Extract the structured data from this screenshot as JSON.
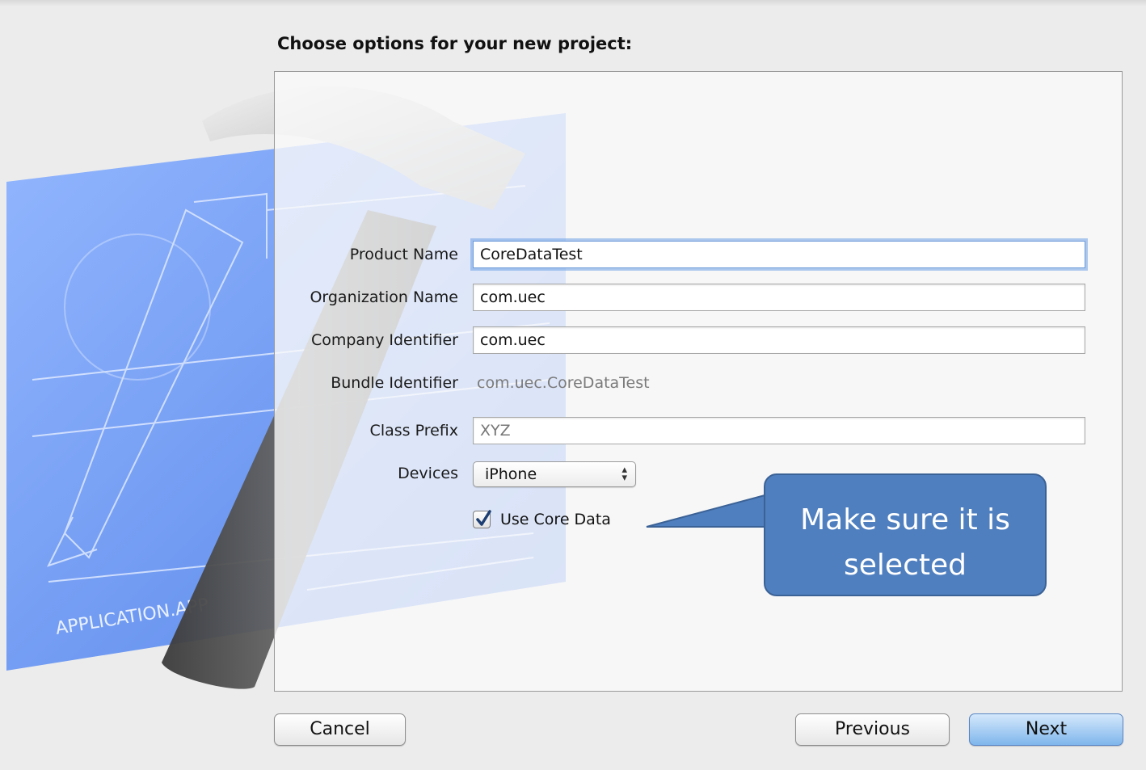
{
  "dialog": {
    "heading": "Choose options for your new project:"
  },
  "artwork": {
    "label": "APPLICATION.APP",
    "icon": "xcode-hammer-blueprint-icon"
  },
  "form": {
    "product_name": {
      "label": "Product Name",
      "value": "CoreDataTest"
    },
    "organization_name": {
      "label": "Organization Name",
      "value": "com.uec"
    },
    "company_identifier": {
      "label": "Company Identifier",
      "value": "com.uec"
    },
    "bundle_identifier": {
      "label": "Bundle Identifier",
      "value": "com.uec.CoreDataTest"
    },
    "class_prefix": {
      "label": "Class Prefix",
      "value": "XYZ"
    },
    "devices": {
      "label": "Devices",
      "selected": "iPhone"
    },
    "use_core_data": {
      "label": "Use Core Data",
      "checked": true
    }
  },
  "buttons": {
    "cancel": "Cancel",
    "previous": "Previous",
    "next": "Next"
  },
  "callout": {
    "text": "Make sure it is selected",
    "color": "#4f7fbf"
  }
}
